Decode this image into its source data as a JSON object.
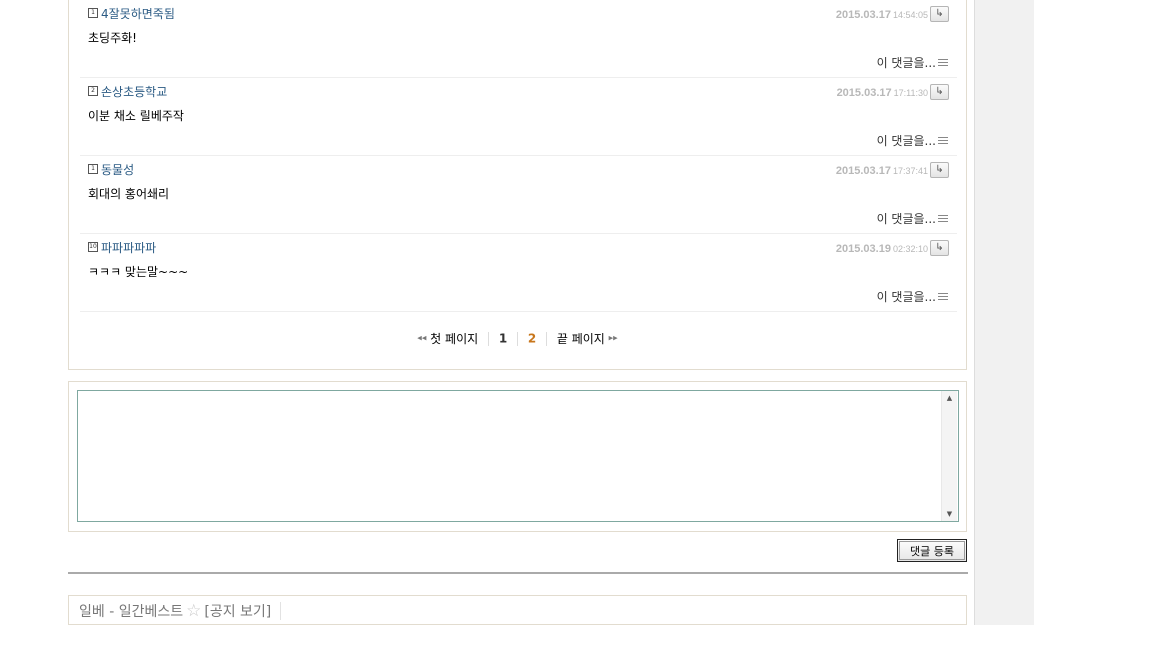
{
  "comments": [
    {
      "level": "1",
      "nick": "4잘못하면죽됨",
      "date": "2015.03.17",
      "time": "14:54:05",
      "body": "초딩주화!",
      "more": "이 댓글을..."
    },
    {
      "level": "2",
      "nick": "손상초등학교",
      "date": "2015.03.17",
      "time": "17:11:30",
      "body": "이분 채소 릴베주작",
      "more": "이 댓글을..."
    },
    {
      "level": "1",
      "nick": "동물성",
      "date": "2015.03.17",
      "time": "17:37:41",
      "body": "회대의 홍어쇄리",
      "more": "이 댓글을..."
    },
    {
      "level": "10",
      "nick": "파파파파파",
      "date": "2015.03.19",
      "time": "02:32:10",
      "body": "ㅋㅋㅋ 맞는말~~~",
      "more": "이 댓글을..."
    }
  ],
  "pager": {
    "first": "첫 페이지",
    "page1": "1",
    "page2": "2",
    "last": "끝 페이지"
  },
  "comment_input": {
    "value": ""
  },
  "submit_label": "댓글 등록",
  "board": {
    "title": "일베 - 일간베스트",
    "notice": "[공지 보기]"
  }
}
